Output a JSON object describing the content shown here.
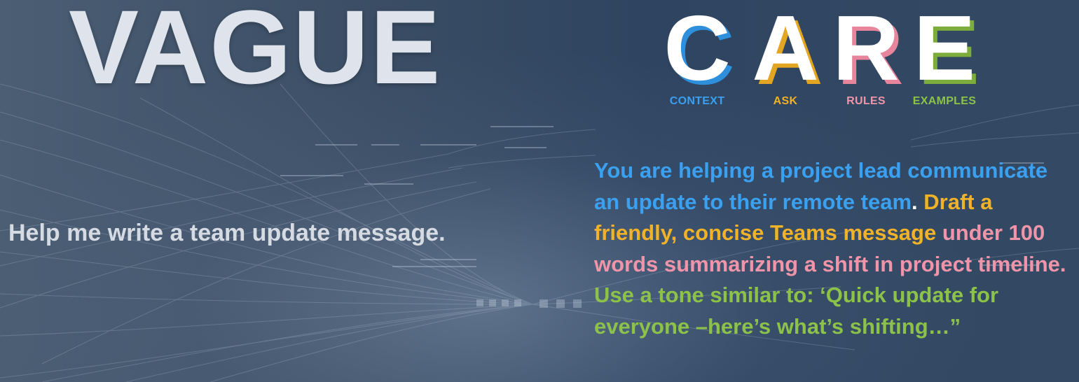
{
  "left": {
    "title": "VAGUE",
    "message": "Help me write a team update message."
  },
  "right": {
    "letters": [
      {
        "letter": "C",
        "word": "CONTEXT",
        "color": "#3aa0ef"
      },
      {
        "letter": "A",
        "word": "ASK",
        "color": "#f0b228"
      },
      {
        "letter": "R",
        "word": "RULES",
        "color": "#f095a9"
      },
      {
        "letter": "E",
        "word": "EXAMPLES",
        "color": "#8cc24a"
      }
    ],
    "prompt": {
      "context": "You are helping a project lead communicate an update to their remote team",
      "period": ". ",
      "ask": "Draft a friendly, concise Teams message ",
      "rules": "under 100 words summarizing a shift in project timeline. ",
      "examples": "Use a tone similar to: ‘Quick update for everyone –here’s what’s shifting…”"
    }
  }
}
